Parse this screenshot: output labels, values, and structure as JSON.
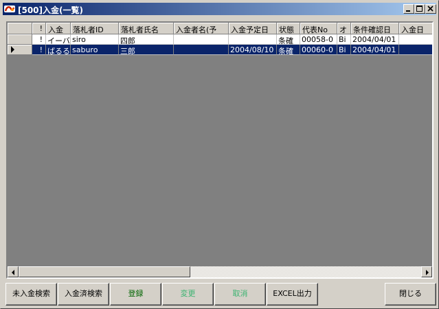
{
  "window": {
    "title": "[500]入金(一覧)",
    "controls": [
      "minimize-icon",
      "maximize-icon",
      "close-icon"
    ]
  },
  "grid": {
    "columns": [
      "!",
      "入金",
      "落札者ID",
      "落札者氏名",
      "入金者名(予",
      "入金予定日",
      "状態",
      "代表No",
      "オ",
      "条件確認日",
      "入金日"
    ],
    "rows": [
      {
        "cells": [
          "!",
          "イーバ",
          "siro",
          "四郎",
          "",
          "",
          "条確",
          "00058-0",
          "Bi",
          "2004/04/01",
          ""
        ],
        "selected": false
      },
      {
        "cells": [
          "!",
          "ばるる",
          "saburo",
          "三郎",
          "",
          "2004/08/10",
          "条確",
          "00060-0",
          "Bi",
          "2004/04/01",
          ""
        ],
        "selected": true
      }
    ]
  },
  "buttons": {
    "unpaid_search": "未入金検索",
    "paid_search": "入金済検索",
    "register": "登録",
    "change": "変更",
    "cancel": "取消",
    "excel_output": "EXCEL出力",
    "close": "閉じる"
  },
  "colors": {
    "titlebar": "#0a246a",
    "selection": "#0a246a",
    "grid_background": "#808080",
    "button_text_green": "#006400",
    "button_text_disabled": "#3cb371"
  }
}
